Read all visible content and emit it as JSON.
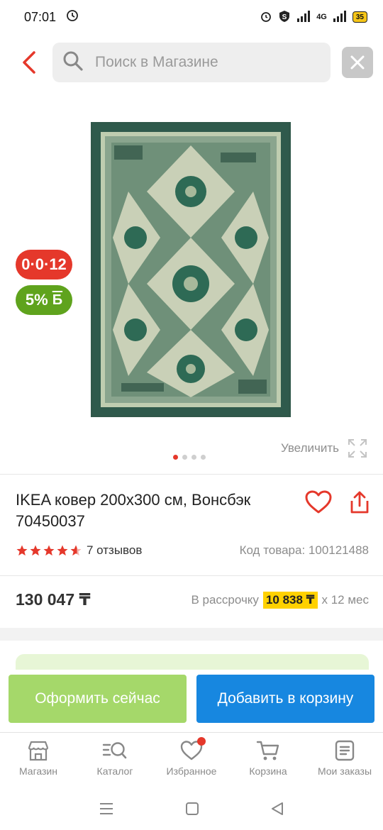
{
  "status": {
    "time": "07:01",
    "network": "4G",
    "battery": "35"
  },
  "search": {
    "placeholder": "Поиск в Магазине"
  },
  "gallery": {
    "badge_installment": "0·0·12",
    "badge_bonus": "5%",
    "badge_bonus_suffix": "Б",
    "zoom_label": "Увеличить",
    "image_count": 4,
    "active_image": 1
  },
  "product": {
    "title": "IKEA ковер 200x300 см, Вонсбэк 70450037",
    "rating": 4.5,
    "reviews": "7 отзывов",
    "sku": "Код товара: 100121488",
    "price": "130 047 ₸",
    "installment_prefix": "В рассрочку",
    "installment_amount": "10 838 ₸",
    "installment_suffix": "x 12 мес"
  },
  "actions": {
    "checkout": "Оформить сейчас",
    "add_to_cart": "Добавить в корзину"
  },
  "tabs": [
    {
      "label": "Магазин",
      "icon": "store-icon"
    },
    {
      "label": "Каталог",
      "icon": "catalog-search-icon"
    },
    {
      "label": "Избранное",
      "icon": "heart-icon"
    },
    {
      "label": "Корзина",
      "icon": "cart-icon"
    },
    {
      "label": "Мои заказы",
      "icon": "orders-icon"
    }
  ],
  "colors": {
    "accent_red": "#e5382b",
    "accent_green": "#5fa31d",
    "checkout_green": "#a5d86a",
    "cart_blue": "#1787e0",
    "installment_yellow": "#ffd100"
  }
}
